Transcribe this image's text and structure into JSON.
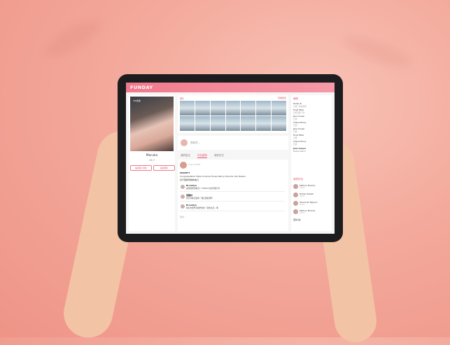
{
  "app": {
    "logo": "FUNDAY"
  },
  "profile": {
    "badge": "VIP會員",
    "name": "Maruko",
    "id": "A8.3",
    "buttons": [
      "編輯個人資料",
      "編輯資料"
    ]
  },
  "gallery": {
    "title": "相片",
    "more": "查看更多"
  },
  "composer": {
    "placeholder": "想說些..."
  },
  "tabs": [
    "我的貼文",
    "好友動態",
    "我的討文"
  ],
  "post": {
    "meta": "Aug 5,2022",
    "author": "MANDYT",
    "line1": "Congratulation Haka Couture Frozen Berry Imports into Taiwan",
    "line2": "好不容易帶她的來口",
    "comments": [
      {
        "name": "Brooklyn",
        "text": "感謝我覺的暖意！FUNDAY好的活動分享"
      },
      {
        "name": "萬顏林",
        "text": "我打算來這邊看一邊這邊看我們"
      },
      {
        "name": "Brooklyn",
        "text": "我家也要學到我們的的「我的生活」哦"
      }
    ],
    "reply_placeholder": "留言..."
  },
  "sidebar": {
    "header": "通知",
    "items": [
      {
        "name": "Darian R.",
        "sub": "已讀了我的動態"
      },
      {
        "name": "Floyd Miles",
        "sub": "已經回覆了你"
      },
      {
        "name": "Jane Cooper",
        "sub": "已讀"
      },
      {
        "name": "Arlene McCoy",
        "sub": "已讀"
      },
      {
        "name": "Jane Cooper",
        "sub": "已讀"
      },
      {
        "name": "Floyd Miles",
        "sub": "已讀"
      },
      {
        "name": "Arlene McCoy",
        "sub": "已讀"
      },
      {
        "name": "Jane Cooper",
        "sub": "Ralph Ward"
      }
    ],
    "friends_header": "我的好友",
    "friends": [
      {
        "name": "Kathryn Murphy",
        "sub": "Online"
      },
      {
        "name": "Darlen Russell",
        "sub": "Online"
      },
      {
        "name": "Savannah Nguyen",
        "sub": "Online"
      },
      {
        "name": "Kathryn Murphy",
        "sub": "Online"
      }
    ],
    "more_label": "更多好友"
  }
}
